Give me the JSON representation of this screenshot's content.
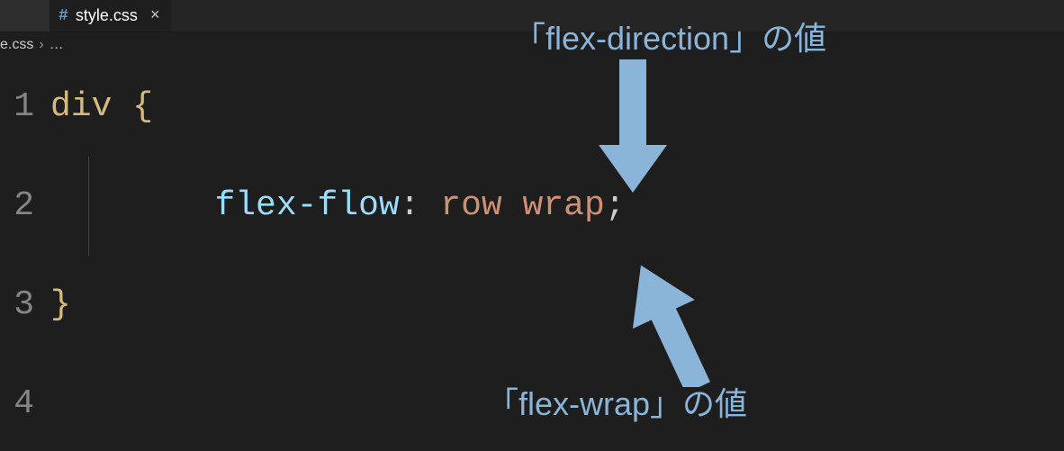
{
  "tab": {
    "filename": "style.css",
    "close_glyph": "×",
    "icon_glyph": "#"
  },
  "breadcrumb": {
    "file": "e.css",
    "chevron": "›",
    "rest": "…"
  },
  "gutter": {
    "l1": "1",
    "l2": "2",
    "l3": "3",
    "l4": "4"
  },
  "code": {
    "selector": "div",
    "open_brace": "{",
    "prop": "flex-flow",
    "colon": ":",
    "val1": "row",
    "val2": "wrap",
    "semi": ";",
    "close_brace": "}"
  },
  "annotations": {
    "top": "「flex-direction」の値",
    "bottom": "「flex-wrap」の値"
  }
}
